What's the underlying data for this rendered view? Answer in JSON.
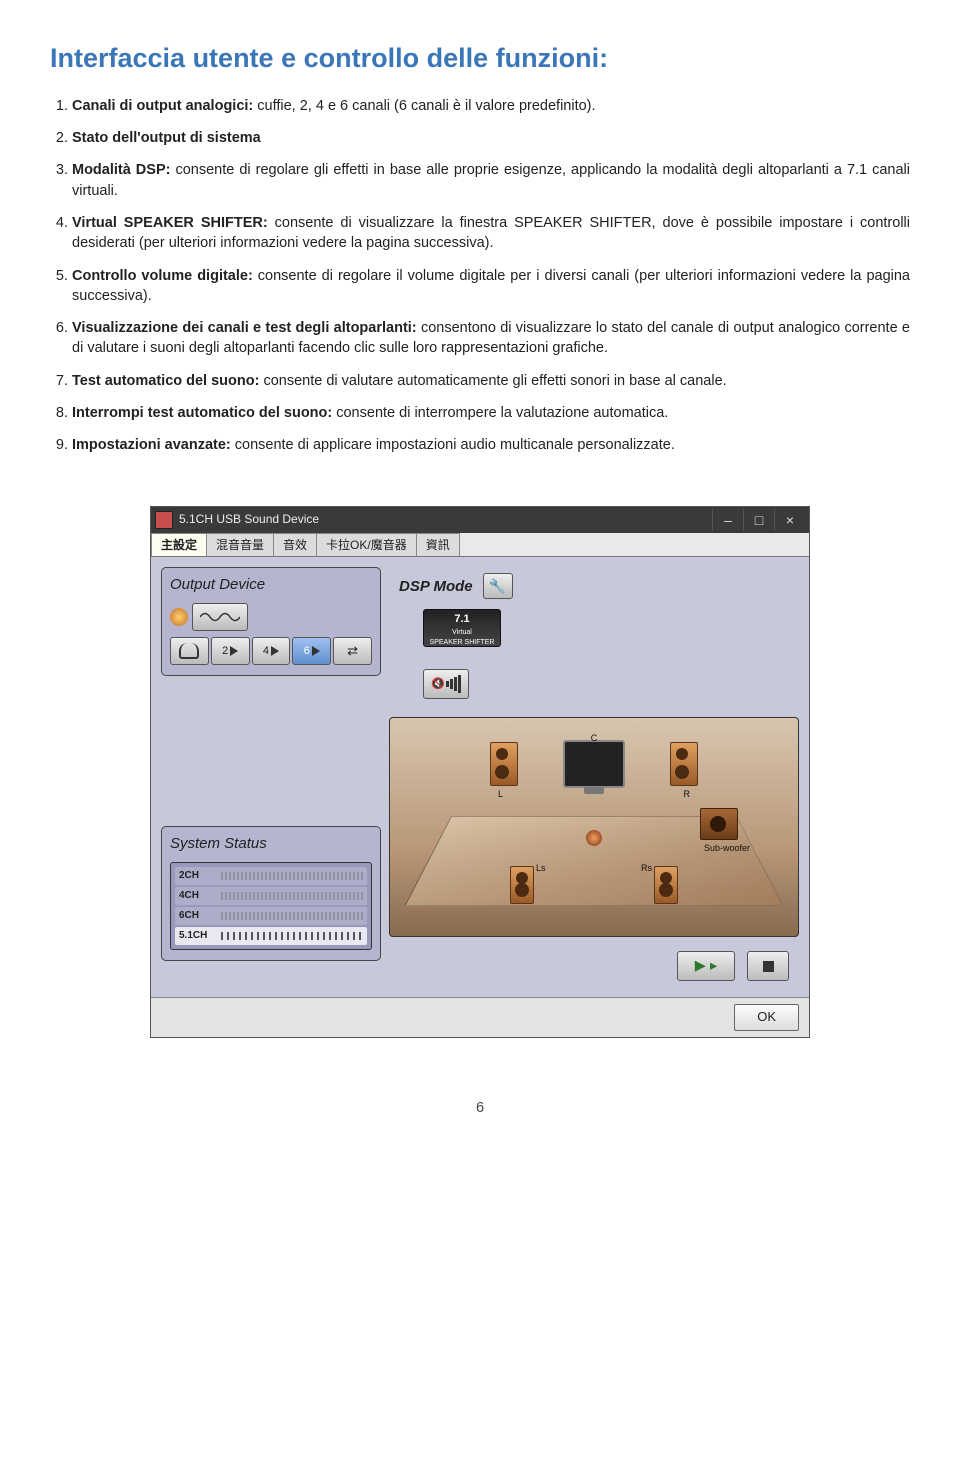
{
  "heading": "Interfaccia utente e controllo delle funzioni:",
  "items": [
    {
      "bold": "Canali di output analogici:",
      "text": " cuffie, 2, 4 e 6 canali (6 canali è il valore predefinito)."
    },
    {
      "bold": "Stato dell'output di sistema",
      "text": ""
    },
    {
      "bold": "Modalità DSP:",
      "text": " consente di regolare gli effetti in base alle proprie esigenze, applicando la modalità degli altoparlanti a 7.1 canali virtuali."
    },
    {
      "bold": "Virtual SPEAKER SHIFTER:",
      "text": " consente di visualizzare la finestra SPEAKER SHIFTER, dove è possibile impostare i controlli desiderati  (per ulteriori informazioni vedere la pagina successiva)."
    },
    {
      "bold": "Controllo volume digitale:",
      "text": " consente di regolare il volume digitale per i diversi canali (per ulteriori informazioni vedere la pagina successiva)."
    },
    {
      "bold": "Visualizzazione dei canali e test degli altoparlanti:",
      "text": " consentono di visualizzare lo stato del canale di output analogico corrente e di valutare i suoni degli altoparlanti facendo clic sulle loro rappresentazioni grafiche."
    },
    {
      "bold": "Test automatico del suono:",
      "text": " consente di valutare automaticamente gli effetti sonori in base al canale."
    },
    {
      "bold": "Interrompi test automatico del suono:",
      "text": " consente di interrompere la valutazione automatica."
    },
    {
      "bold": "Impostazioni avanzate:",
      "text": " consente di applicare impostazioni audio multicanale personalizzate."
    }
  ],
  "window": {
    "title": "5.1CH USB Sound Device",
    "tabs": [
      "主設定",
      "混音音量",
      "音效",
      "卡拉OK/魔音器",
      "資訊"
    ],
    "output_device_label": "Output Device",
    "channels": [
      "2",
      "4",
      "6"
    ],
    "system_status_label": "System Status",
    "status_rows": [
      "2CH",
      "4CH",
      "6CH",
      "5.1CH"
    ],
    "dsp_label": "DSP Mode",
    "dsp_btn_l1": "7.1",
    "dsp_btn_l2": "Virtual",
    "dsp_btn_l3": "SPEAKER SHIFTER",
    "speaker_labels": {
      "L": "L",
      "C": "C",
      "R": "R",
      "Ls": "Ls",
      "Rs": "Rs",
      "Sub": "Sub-woofer"
    },
    "ok": "OK"
  },
  "page_number": "6"
}
